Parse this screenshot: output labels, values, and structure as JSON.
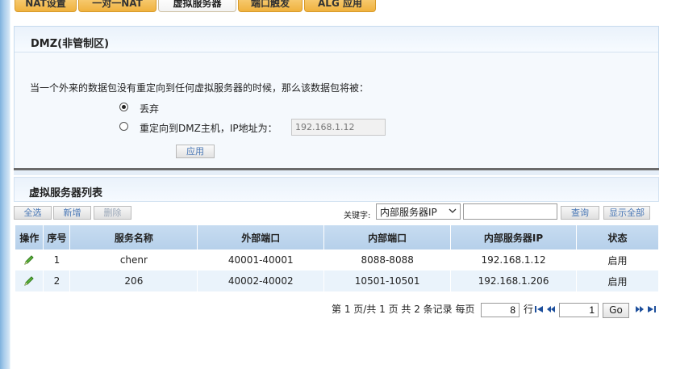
{
  "tabs": [
    {
      "label": "NAT设置",
      "active": false
    },
    {
      "label": "一对一NAT",
      "active": false
    },
    {
      "label": "虚拟服务器",
      "active": true
    },
    {
      "label": "端口触发",
      "active": false
    },
    {
      "label": "ALG 应用",
      "active": false
    }
  ],
  "dmz": {
    "title": "DMZ(非管制区)",
    "description": "当一个外来的数据包没有重定向到任何虚拟服务器的时候，那么该数据包将被：",
    "option_drop": "丢弃",
    "option_redirect": "重定向到DMZ主机，IP地址为：",
    "selected": "drop",
    "ip_value": "192.168.1.12",
    "apply_label": "应用"
  },
  "list": {
    "title": "虚拟服务器列表",
    "toolbar": {
      "select_all": "全选",
      "add": "新增",
      "delete": "删除",
      "keyword_label": "关键字:",
      "keyword_field": "内部服务器IP",
      "keyword_value": "",
      "search": "查询",
      "show_all": "显示全部"
    },
    "columns": [
      "操作",
      "序号",
      "服务名称",
      "外部端口",
      "内部端口",
      "内部服务器IP",
      "状态"
    ],
    "rows": [
      {
        "index": "1",
        "name": "chenr",
        "ext_port": "40001-40001",
        "int_port": "8088-8088",
        "ip": "192.168.1.12",
        "status": "启用"
      },
      {
        "index": "2",
        "name": "206",
        "ext_port": "40002-40002",
        "int_port": "10501-10501",
        "ip": "192.168.1.206",
        "status": "启用"
      }
    ]
  },
  "pager": {
    "summary": "第 1 页/共 1 页 共 2 条记录 每页",
    "per_page": "8",
    "rows_label": "行",
    "page": "1",
    "go_label": "Go"
  },
  "colors": {
    "tab": "#f0b23e",
    "header": "#bcd5ee",
    "link": "#4a78b6"
  }
}
